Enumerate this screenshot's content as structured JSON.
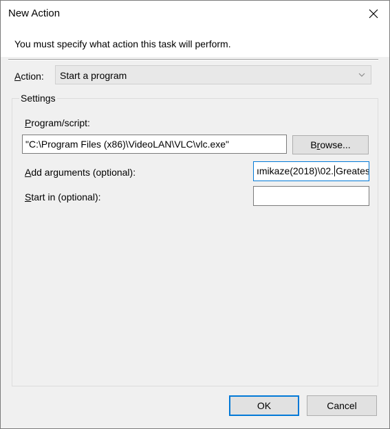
{
  "window": {
    "title": "New Action",
    "close_glyph": "close-icon"
  },
  "header": {
    "message": "You must specify what action this task will perform."
  },
  "action": {
    "label_prefix": "",
    "label_underlined": "A",
    "label_rest": "ction:",
    "selected_value": "Start a program"
  },
  "settings": {
    "legend": "Settings",
    "program": {
      "label_underlined": "P",
      "label_rest": "rogram/script:",
      "value": "\"C:\\Program Files (x86)\\VideoLAN\\VLC\\vlc.exe\""
    },
    "browse_button": {
      "label_pre": "B",
      "label_underlined": "r",
      "label_rest": "owse..."
    },
    "arguments": {
      "label_underlined": "A",
      "label_rest": "dd arguments (optional):",
      "value_before_caret": "ımikaze(2018)\\02.",
      "value_after_caret": "Greatest"
    },
    "start_in": {
      "label_underlined": "S",
      "label_rest": "tart in (optional):",
      "value": ""
    }
  },
  "buttons": {
    "ok": "OK",
    "cancel": "Cancel"
  },
  "colors": {
    "accent": "#0078d7",
    "dialog_bg": "#f0f0f0",
    "button_bg": "#e1e1e1"
  }
}
